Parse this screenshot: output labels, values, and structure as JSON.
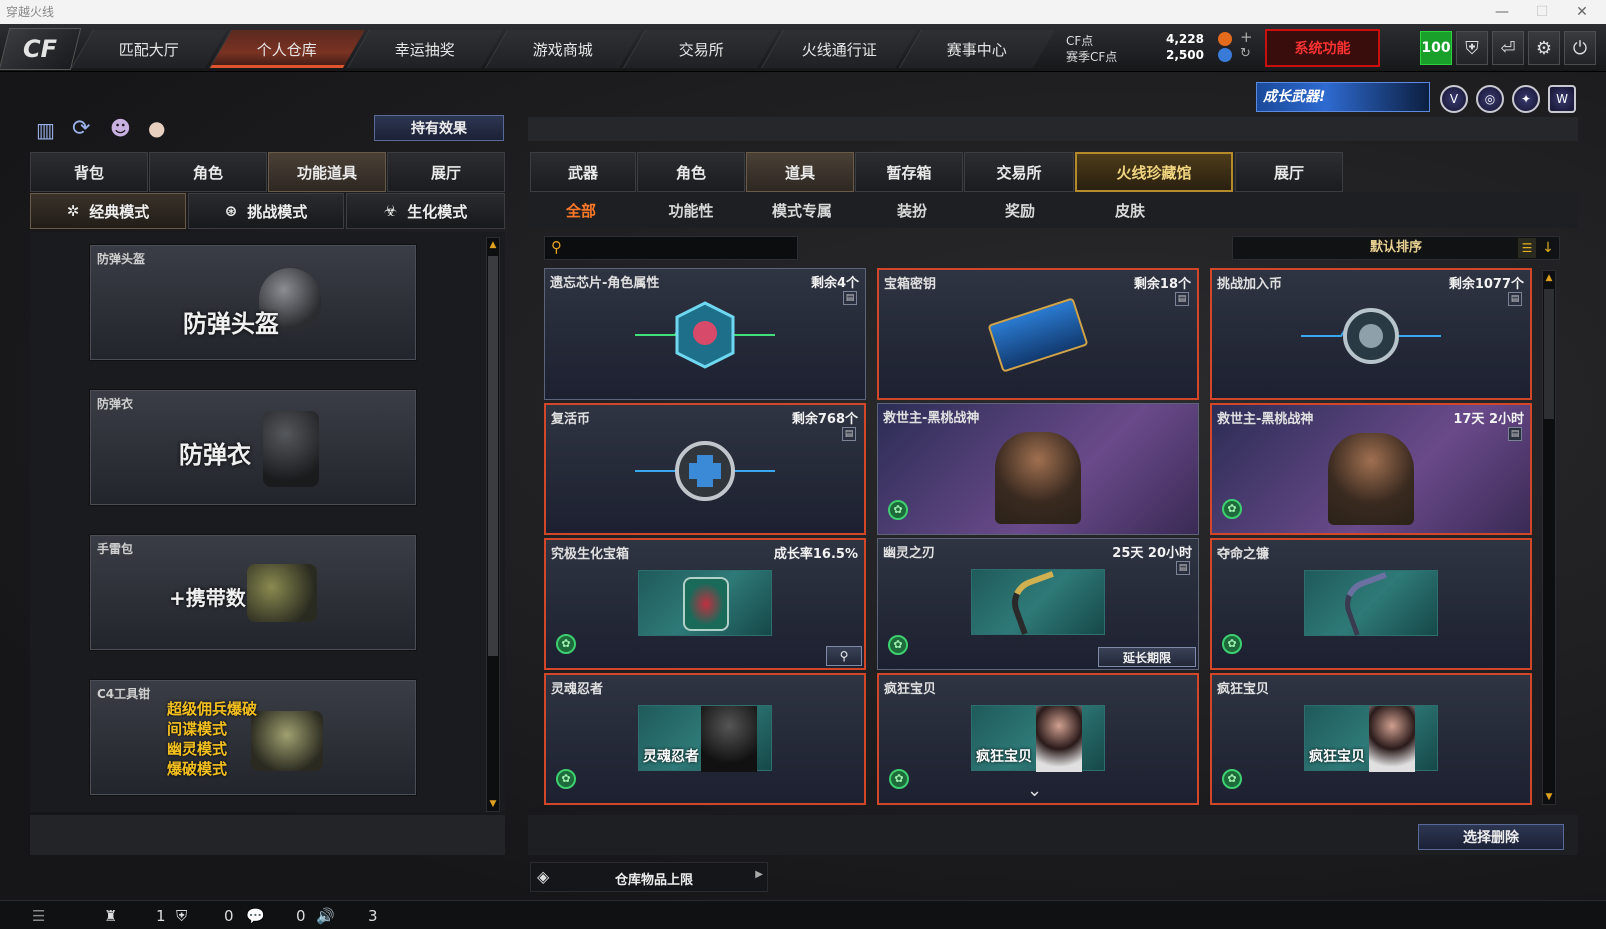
{
  "window": {
    "title": "穿越火线"
  },
  "nav": {
    "tabs": [
      "匹配大厅",
      "个人仓库",
      "幸运抽奖",
      "游戏商城",
      "交易所",
      "火线通行证",
      "赛事中心"
    ],
    "active": "个人仓库"
  },
  "currency": {
    "cf_label": "CF点",
    "cf_value": "4,228",
    "season_label": "赛季CF点",
    "season_value": "2,500"
  },
  "promo": {
    "label": "系统功能"
  },
  "level": "100",
  "banner": {
    "label": "成长武器!"
  },
  "left": {
    "owned_effects": "持有效果",
    "tabs": [
      "背包",
      "角色",
      "功能道具",
      "展厅"
    ],
    "active_tab": "功能道具",
    "modes": [
      "经典模式",
      "挑战模式",
      "生化模式"
    ],
    "items": [
      {
        "label": "防弹头盔",
        "big": "防弹头盔"
      },
      {
        "label": "防弹衣",
        "big": "防弹衣"
      },
      {
        "label": "手雷包",
        "big": "+携带数"
      },
      {
        "label": "C4工具钳",
        "lines": [
          "超级佣兵爆破",
          "间谍模式",
          "幽灵模式",
          "爆破模式"
        ]
      }
    ]
  },
  "right": {
    "tabs": [
      "武器",
      "角色",
      "道具",
      "暂存箱",
      "交易所",
      "火线珍藏馆",
      "展厅"
    ],
    "active_tab": "道具",
    "subtabs": [
      "全部",
      "功能性",
      "模式专属",
      "装扮",
      "奖励",
      "皮肤"
    ],
    "active_subtab": "全部",
    "search_placeholder": "",
    "sort_label": "默认排序",
    "items": [
      {
        "name": "遗忘芯片-角色属性",
        "count": "剩余4个"
      },
      {
        "name": "宝箱密钥",
        "count": "剩余18个"
      },
      {
        "name": "挑战加入币",
        "count": "剩余1077个"
      },
      {
        "name": "复活币",
        "count": "剩余768个"
      },
      {
        "name": "救世主-黑桃战神",
        "count": ""
      },
      {
        "name": "救世主-黑桃战神",
        "count": "17天 2小时"
      },
      {
        "name": "究极生化宝箱",
        "count": "成长率16.5%"
      },
      {
        "name": "幽灵之刃",
        "count": "25天 20小时",
        "action": "延长期限"
      },
      {
        "name": "夺命之镰",
        "count": ""
      },
      {
        "name": "灵魂忍者",
        "count": "",
        "art_text": "灵魂忍者"
      },
      {
        "name": "疯狂宝贝",
        "count": "",
        "art_text": "疯狂宝贝"
      },
      {
        "name": "疯狂宝贝",
        "count": "",
        "art_text": "疯狂宝贝"
      }
    ],
    "select_delete": "选择删除",
    "capacity_label": "仓库物品上限"
  },
  "status": {
    "v1": "1",
    "v2": "0",
    "v3": "0",
    "v4": "3"
  }
}
